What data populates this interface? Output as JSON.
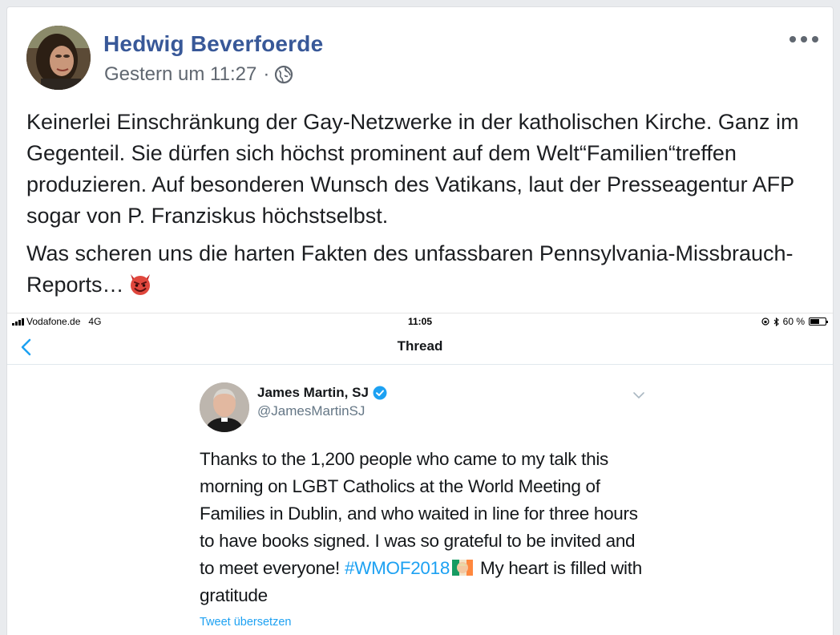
{
  "post": {
    "author_name": "Hedwig Beverfoerde",
    "timestamp": "Gestern um 11:27",
    "separator": "·",
    "privacy_icon": "globe-icon",
    "more_icon": "more-dots-icon",
    "paragraph_1": "Keinerlei Einschränkung der Gay-Netzwerke in der katholischen Kirche. Ganz im Gegenteil. Sie dürfen sich höchst prominent auf dem Welt“Familien“treffen produzieren. Auf besonderen Wunsch des Vatikans, laut der Presseagentur AFP sogar von P. Franziskus höchstselbst.",
    "paragraph_2": "Was scheren uns die harten Fakten des unfassbaren Pennsylvania-Missbrauch-Reports…",
    "paragraph_2_emoji": "devil-emoji"
  },
  "screenshot": {
    "status_bar": {
      "carrier": "Vodafone.de",
      "network": "4G",
      "time": "11:05",
      "battery": "60 %",
      "battery_level": 0.6
    },
    "nav": {
      "title": "Thread",
      "back_icon": "chevron-left-icon"
    },
    "tweet": {
      "name": "James Martin, SJ",
      "handle": "@JamesMartinSJ",
      "text_before_hashtag": "Thanks to the 1,200 people who came to my talk this morning on LGBT Catholics at the World Meeting of Families in Dublin, and who waited in line for three hours to have books signed. I was so grateful to be invited and to meet everyone!",
      "hashtag": "#WMOF2018",
      "text_after_hashtag": "My heart is filled with gratitude",
      "translate_label": "Tweet übersetzen"
    }
  },
  "colors": {
    "facebook_link": "#385898",
    "twitter_blue": "#1da1f2"
  }
}
